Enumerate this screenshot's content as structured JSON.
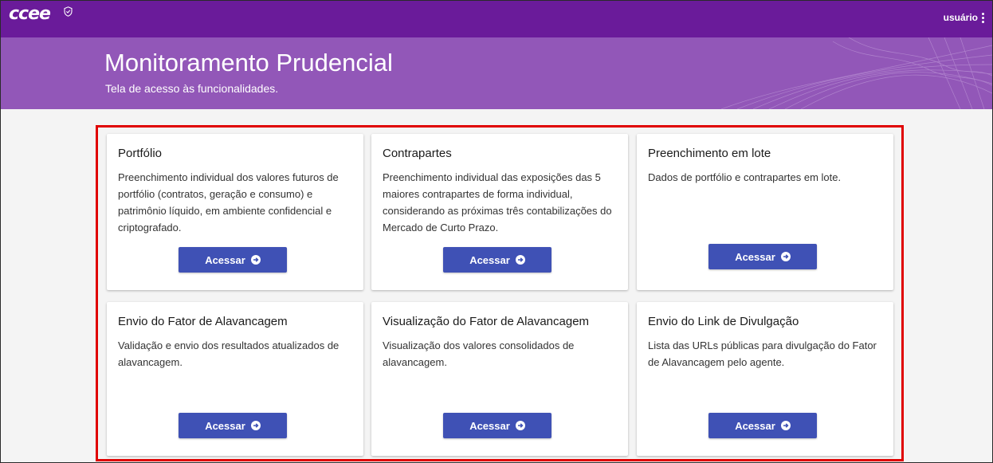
{
  "header": {
    "logo_text": "ccee",
    "user_label": "usuário"
  },
  "banner": {
    "title": "Monitoramento Prudencial",
    "subtitle": "Tela de acesso às funcionalidades."
  },
  "cards": [
    {
      "title": "Portfólio",
      "description": "Preenchimento individual dos valores futuros de portfólio (contratos, geração e consumo) e patrimônio líquido, em ambiente confidencial e criptografado.",
      "button_label": "Acessar"
    },
    {
      "title": "Contrapartes",
      "description": "Preenchimento individual das exposições das 5 maiores contrapartes de forma individual, considerando as próximas três contabilizações do Mercado de Curto Prazo.",
      "button_label": "Acessar"
    },
    {
      "title": "Preenchimento em lote",
      "description": "Dados de portfólio e contrapartes em lote.",
      "button_label": "Acessar"
    },
    {
      "title": "Envio do Fator de Alavancagem",
      "description": "Validação e envio dos resultados atualizados de alavancagem.",
      "button_label": "Acessar"
    },
    {
      "title": "Visualização do Fator de Alavancagem",
      "description": "Visualização dos valores consolidados de alavancagem.",
      "button_label": "Acessar"
    },
    {
      "title": "Envio do Link de Divulgação",
      "description": "Lista das URLs públicas para divulgação do Fator de Alavancagem pelo agente.",
      "button_label": "Acessar"
    }
  ],
  "colors": {
    "topbar": "#6a1b9a",
    "banner": "#9257b8",
    "button": "#3f51b5",
    "highlight": "#e00000"
  },
  "icons": {
    "logo_badge": "shield-check-icon",
    "user_menu": "more-vert-icon",
    "button": "arrow-circle-right-icon"
  }
}
